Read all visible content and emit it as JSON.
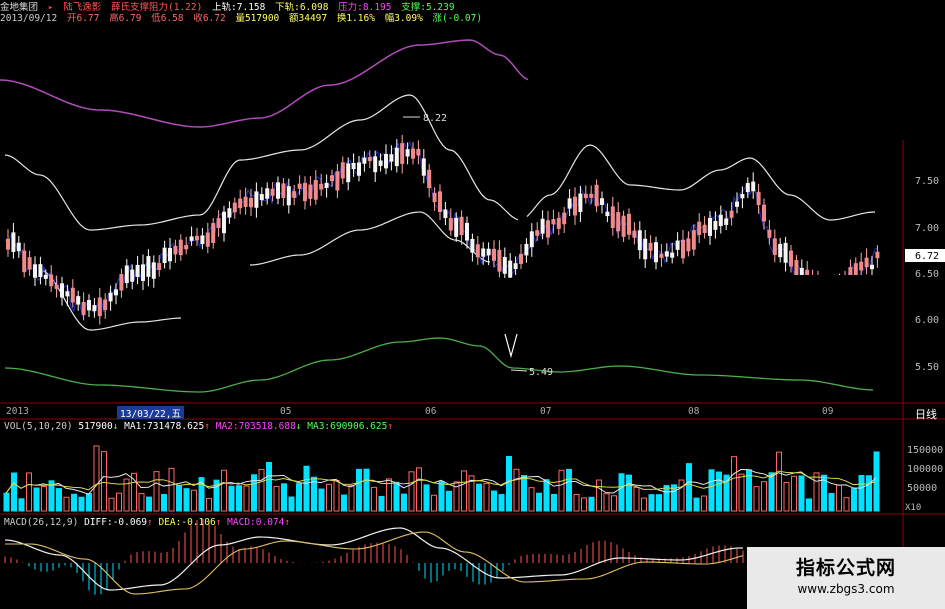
{
  "header": {
    "stock": "金地集团",
    "formula": "陆飞逸影",
    "indicator": "薛氏支撑阻力(1.22)",
    "upper": "上轨:7.158",
    "lower": "下轨:6.098",
    "pressure": "压力:8.195",
    "support": "支撑:5.239",
    "date": "2013/09/12",
    "open": "开6.77",
    "high": "高6.79",
    "low": "低6.58",
    "close": "收6.72",
    "volume": "量517900",
    "amount": "额34497",
    "turnover": "换1.16%",
    "amplitude": "幅3.09%",
    "change": "涨(-0.07)"
  },
  "price_axis": {
    "ticks": [
      "7.50",
      "7.00",
      "6.50",
      "6.00",
      "5.50"
    ],
    "current": "6.72"
  },
  "annotations": {
    "high_label": "8.22",
    "low_label": "5.49"
  },
  "date_axis": {
    "labels": [
      "2013",
      "05",
      "06",
      "07",
      "08",
      "09"
    ],
    "cursor": "13/03/22,五",
    "period": "日线"
  },
  "volume_panel": {
    "title": "VOL(5,10,20)",
    "value": "517900",
    "ma1": "MA1:731478.625",
    "ma2": "MA2:703518.688",
    "ma3": "MA3:690906.625",
    "ticks": [
      "150000",
      "100000",
      "50000"
    ],
    "unit": "X10"
  },
  "macd_panel": {
    "title": "MACD(26,12,9)",
    "diff": "DIFF:-0.069",
    "dea": "DEA:-0.106",
    "macd": "MACD:0.074"
  },
  "watermark": {
    "title": "指标公式网",
    "url": "www.zbgs3.com"
  },
  "colors": {
    "up": "#ff6666",
    "down": "#00e0ff",
    "bg": "#000000",
    "grid": "#8b0000"
  }
}
